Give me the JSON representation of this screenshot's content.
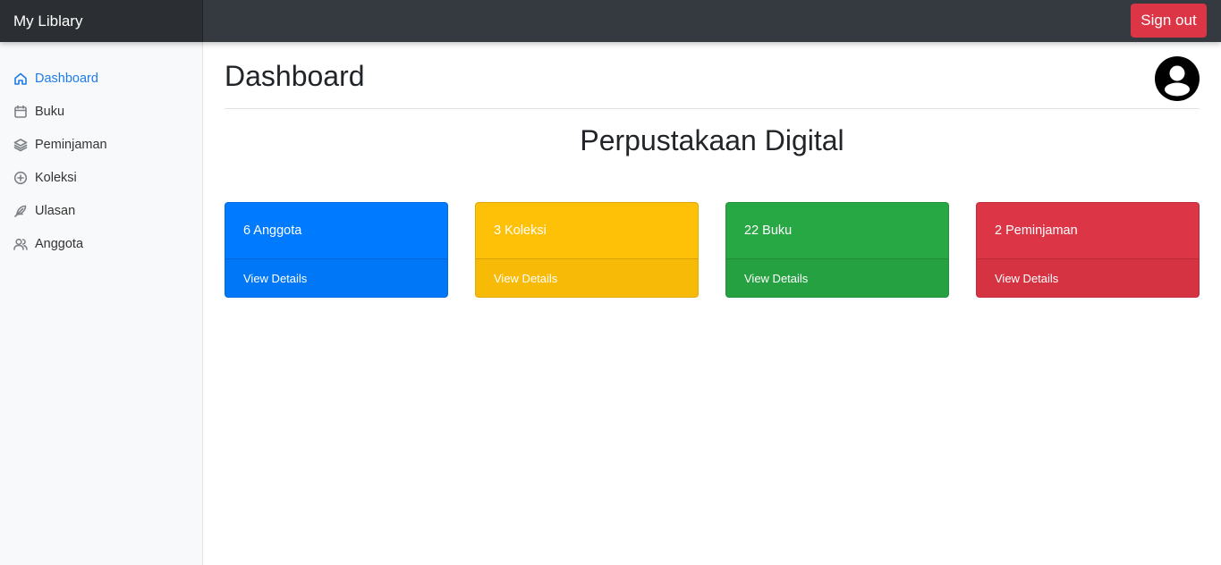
{
  "navbar": {
    "brand": "My Liblary",
    "signout_label": "Sign out"
  },
  "sidebar": {
    "items": [
      {
        "label": "Dashboard",
        "icon": "home-icon",
        "active": true
      },
      {
        "label": "Buku",
        "icon": "calendar-icon"
      },
      {
        "label": "Peminjaman",
        "icon": "layers-icon"
      },
      {
        "label": "Koleksi",
        "icon": "plus-circle-icon"
      },
      {
        "label": "Ulasan",
        "icon": "feather-icon"
      },
      {
        "label": "Anggota",
        "icon": "users-icon"
      }
    ]
  },
  "main": {
    "title": "Dashboard",
    "subtitle": "Perpustakaan Digital",
    "avatar_icon": "user-circle-icon",
    "cards": [
      {
        "label": "6 Anggota",
        "footer": "View Details",
        "color": "#007bff"
      },
      {
        "label": "3 Koleksi",
        "footer": "View Details",
        "color": "#ffc107"
      },
      {
        "label": "22 Buku",
        "footer": "View Details",
        "color": "#28a745"
      },
      {
        "label": "2 Peminjaman",
        "footer": "View Details",
        "color": "#dc3545"
      }
    ]
  },
  "colors": {
    "navbar": "#343a40",
    "active_link": "#1e7ce8",
    "signout": "#dc3545"
  }
}
